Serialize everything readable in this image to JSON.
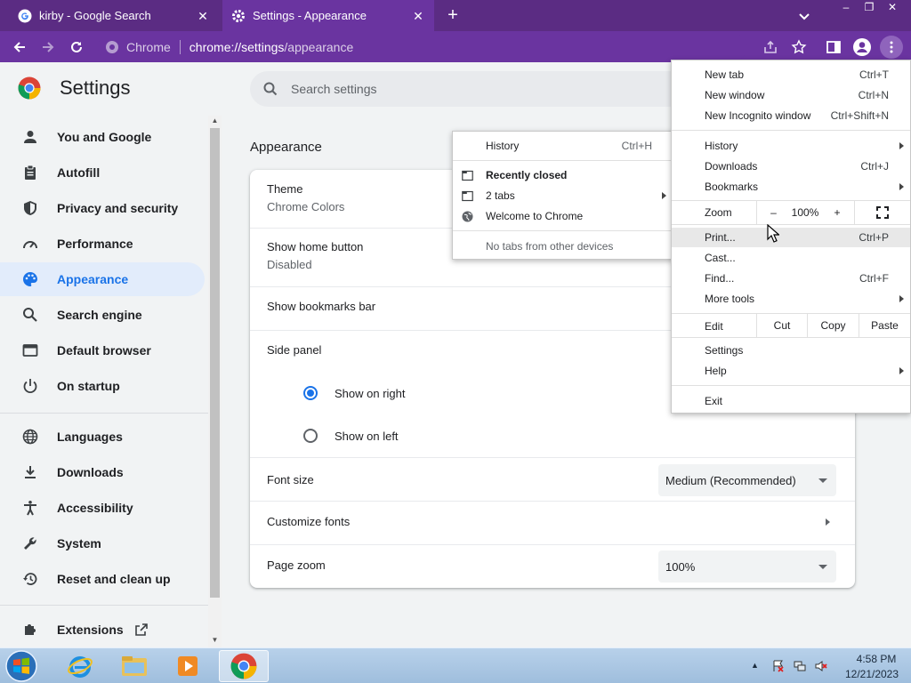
{
  "browser": {
    "tabs": [
      {
        "title": "kirby - Google Search",
        "icon": "google-icon"
      },
      {
        "title": "Settings - Appearance",
        "icon": "gear-icon"
      }
    ],
    "new_tab_label": "+",
    "window_buttons": [
      "–",
      "❐",
      "✕"
    ],
    "omnibox": {
      "site_label": "Chrome",
      "url_host": "chrome://settings",
      "url_path": "/appearance"
    }
  },
  "settings": {
    "title": "Settings",
    "search_placeholder": "Search settings",
    "nav": [
      {
        "label": "You and Google",
        "icon": "person-icon"
      },
      {
        "label": "Autofill",
        "icon": "clipboard-icon"
      },
      {
        "label": "Privacy and security",
        "icon": "shield-icon"
      },
      {
        "label": "Performance",
        "icon": "speedometer-icon"
      },
      {
        "label": "Appearance",
        "icon": "palette-icon",
        "active": true
      },
      {
        "label": "Search engine",
        "icon": "search-icon"
      },
      {
        "label": "Default browser",
        "icon": "browser-window-icon"
      },
      {
        "label": "On startup",
        "icon": "power-icon"
      },
      {
        "label": "Languages",
        "icon": "globe-icon"
      },
      {
        "label": "Downloads",
        "icon": "download-icon"
      },
      {
        "label": "Accessibility",
        "icon": "accessibility-icon"
      },
      {
        "label": "System",
        "icon": "wrench-icon"
      },
      {
        "label": "Reset and clean up",
        "icon": "history-icon"
      },
      {
        "label": "Extensions",
        "icon": "puzzle-icon"
      }
    ],
    "section_title": "Appearance",
    "theme": {
      "title": "Theme",
      "value": "Chrome Colors"
    },
    "home_button": {
      "title": "Show home button",
      "value": "Disabled"
    },
    "bookmarks_bar": {
      "title": "Show bookmarks bar"
    },
    "side_panel": {
      "title": "Side panel",
      "options": [
        "Show on right",
        "Show on left"
      ],
      "selected": "Show on right"
    },
    "font_size": {
      "title": "Font size",
      "value": "Medium (Recommended)"
    },
    "customize_fonts": {
      "title": "Customize fonts"
    },
    "page_zoom": {
      "title": "Page zoom",
      "value": "100%"
    }
  },
  "history_menu": {
    "history": {
      "label": "History",
      "shortcut": "Ctrl+H"
    },
    "recently_closed": "Recently closed",
    "entries": [
      {
        "label": "2 tabs",
        "icon": "tab-window-icon",
        "submenu": true
      },
      {
        "label": "Welcome to Chrome",
        "icon": "globe-icon"
      }
    ],
    "no_tabs": "No tabs from other devices"
  },
  "main_menu": {
    "items_top": [
      {
        "label": "New tab",
        "shortcut": "Ctrl+T"
      },
      {
        "label": "New window",
        "shortcut": "Ctrl+N"
      },
      {
        "label": "New Incognito window",
        "shortcut": "Ctrl+Shift+N"
      }
    ],
    "items_mid": [
      {
        "label": "History",
        "shortcut": "",
        "submenu": true
      },
      {
        "label": "Downloads",
        "shortcut": "Ctrl+J"
      },
      {
        "label": "Bookmarks",
        "shortcut": "",
        "submenu": true
      }
    ],
    "zoom": {
      "label": "Zoom",
      "minus": "–",
      "value": "100%",
      "plus": "+"
    },
    "items_tools": [
      {
        "label": "Print...",
        "shortcut": "Ctrl+P",
        "highlight": true
      },
      {
        "label": "Cast...",
        "shortcut": ""
      },
      {
        "label": "Find...",
        "shortcut": "Ctrl+F"
      },
      {
        "label": "More tools",
        "shortcut": "",
        "submenu": true
      }
    ],
    "edit": {
      "label": "Edit",
      "cut": "Cut",
      "copy": "Copy",
      "paste": "Paste"
    },
    "items_bottom": [
      {
        "label": "Settings",
        "shortcut": ""
      },
      {
        "label": "Help",
        "shortcut": "",
        "submenu": true
      }
    ],
    "exit": "Exit"
  },
  "taskbar": {
    "apps": [
      "internet-explorer-icon",
      "file-explorer-icon",
      "media-player-icon",
      "chrome-icon"
    ],
    "time": "4:58 PM",
    "date": "12/21/2023"
  },
  "colors": {
    "accent": "#1a73e8",
    "frame": "#5b2c83",
    "toolbar": "#6a34a0"
  }
}
